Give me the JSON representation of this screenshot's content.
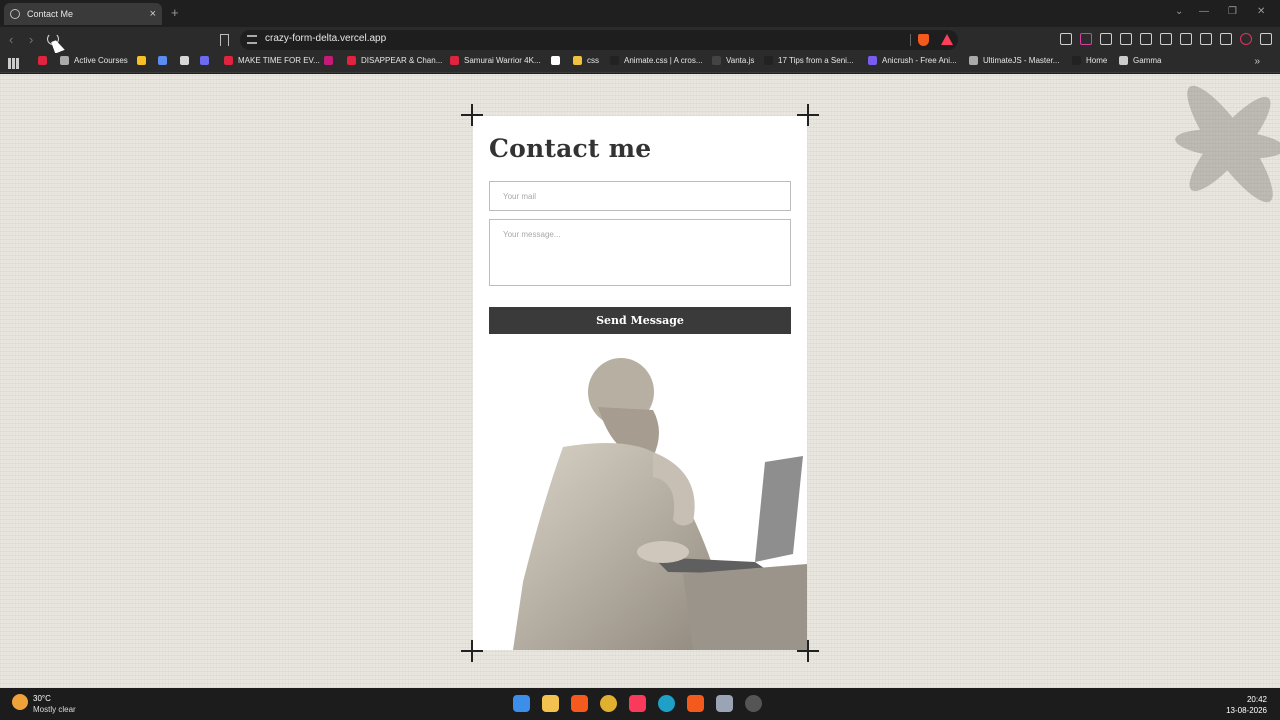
{
  "browser": {
    "tab_title": "Contact Me",
    "tab_close": "×",
    "new_tab": "+",
    "url": "crazy-form-delta.vercel.app",
    "window_controls": [
      "⌄",
      "—",
      "❐",
      "✕"
    ]
  },
  "bookmarks": [
    {
      "label": "",
      "color": "#e0233e"
    },
    {
      "label": "Active Courses",
      "color": "#aaaaaa"
    },
    {
      "label": "",
      "color": "#f6c026"
    },
    {
      "label": "",
      "color": "#5b8cf0"
    },
    {
      "label": "",
      "color": "#d8d8d8"
    },
    {
      "label": "",
      "color": "#6b6bf0"
    },
    {
      "label": "MAKE TIME FOR EV...",
      "color": "#e0233e"
    },
    {
      "label": "",
      "color": "#c61a7a"
    },
    {
      "label": "DISAPPEAR & Chan...",
      "color": "#e0233e"
    },
    {
      "label": "Samurai Warrior 4K...",
      "color": "#e0233e"
    },
    {
      "label": "",
      "color": "#ffffff"
    },
    {
      "label": "css",
      "color": "#f0c040"
    },
    {
      "label": "Animate.css | A cros...",
      "color": "#222222"
    },
    {
      "label": "Vanta.js",
      "color": "#444444"
    },
    {
      "label": "17 Tips from a Seni...",
      "color": "#222222"
    },
    {
      "label": "Anicrush - Free Ani...",
      "color": "#7a5cf0"
    },
    {
      "label": "UltimateJS - Master...",
      "color": "#aaaaaa"
    },
    {
      "label": "Home",
      "color": "#222222"
    },
    {
      "label": "Gamma",
      "color": "#cccccc"
    }
  ],
  "bookmarks_more": "»",
  "form": {
    "title": "Contact me",
    "email_placeholder": "Your mail",
    "message_placeholder": "Your message...",
    "submit_label": "Send Message"
  },
  "taskbar": {
    "temperature": "30°C",
    "weather": "Mostly clear",
    "time": "20:42",
    "date": "13-08-2026",
    "apps": [
      "windows-start",
      "file-explorer",
      "brave",
      "chrome",
      "music",
      "edge",
      "brave-2",
      "capture",
      "recorder"
    ]
  },
  "colors": {
    "page_bg": "#e9e6df",
    "button_bg": "#3a3a3a",
    "accent_brave": "#f25a1e"
  }
}
